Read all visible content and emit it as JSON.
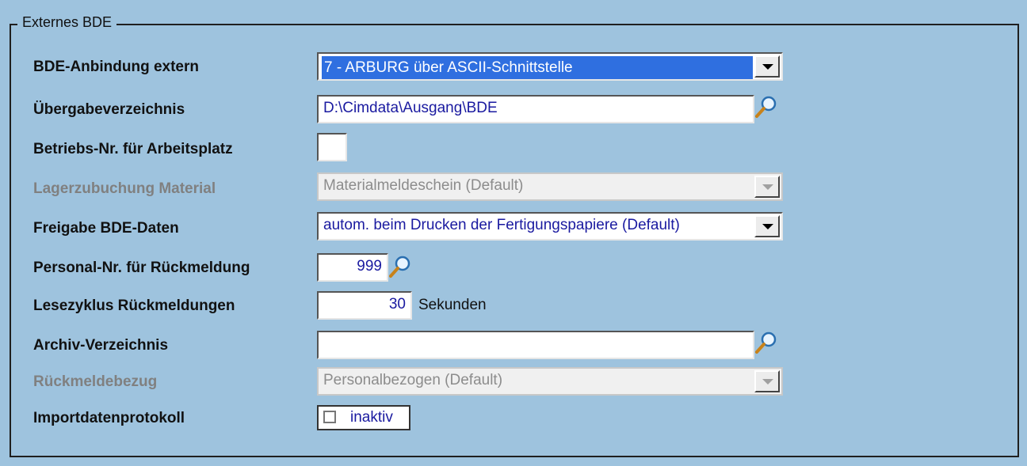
{
  "group": {
    "title": "Externes BDE"
  },
  "rows": {
    "bde_anbindung": {
      "label": "BDE-Anbindung extern",
      "value": "7 - ARBURG über ASCII-Schnittstelle"
    },
    "uebergabe": {
      "label": "Übergabeverzeichnis",
      "value": "D:\\Cimdata\\Ausgang\\BDE"
    },
    "betriebs_nr": {
      "label": "Betriebs-Nr. für Arbeitsplatz",
      "value": ""
    },
    "lagerzubuchung": {
      "label": "Lagerzubuchung Material",
      "value": "Materialmeldeschein (Default)"
    },
    "freigabe": {
      "label": "Freigabe BDE-Daten",
      "value": "autom. beim Drucken der Fertigungspapiere (Default)"
    },
    "personal_nr": {
      "label": "Personal-Nr. für Rückmeldung",
      "value": "999"
    },
    "lesezyklus": {
      "label": "Lesezyklus Rückmeldungen",
      "value": "30",
      "unit": "Sekunden"
    },
    "archiv": {
      "label": "Archiv-Verzeichnis",
      "value": ""
    },
    "rueckmeldebezug": {
      "label": "Rückmeldebezug",
      "value": "Personalbezogen (Default)"
    },
    "importprotokoll": {
      "label": "Importdatenprotokoll",
      "value": "inaktiv",
      "checked": false
    }
  }
}
